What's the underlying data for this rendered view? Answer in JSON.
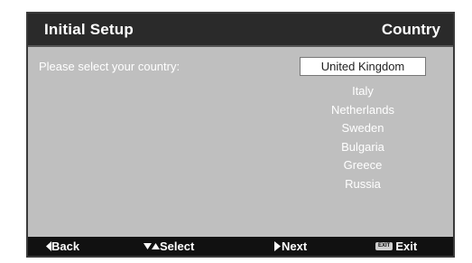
{
  "header": {
    "title": "Initial Setup",
    "section": "Country"
  },
  "prompt": "Please select your country:",
  "country_select": {
    "selected": "United Kingdom",
    "options": [
      "Italy",
      "Netherlands",
      "Sweden",
      "Bulgaria",
      "Greece",
      "Russia"
    ]
  },
  "footer": {
    "back_label": "Back",
    "select_label": "Select",
    "next_label": "Next",
    "exit_key_label": "EXIT",
    "exit_label": "Exit"
  },
  "colors": {
    "panel_background": "#bfbfbf",
    "title_bar": "#2a2a2a",
    "footer_bar": "#111111",
    "text": "#ffffff",
    "selected_background": "#ffffff"
  },
  "icons": {
    "back": "arrow-left-icon",
    "select": "arrow-down-up-icon",
    "next": "arrow-right-icon",
    "exit": "exit-key-icon"
  }
}
